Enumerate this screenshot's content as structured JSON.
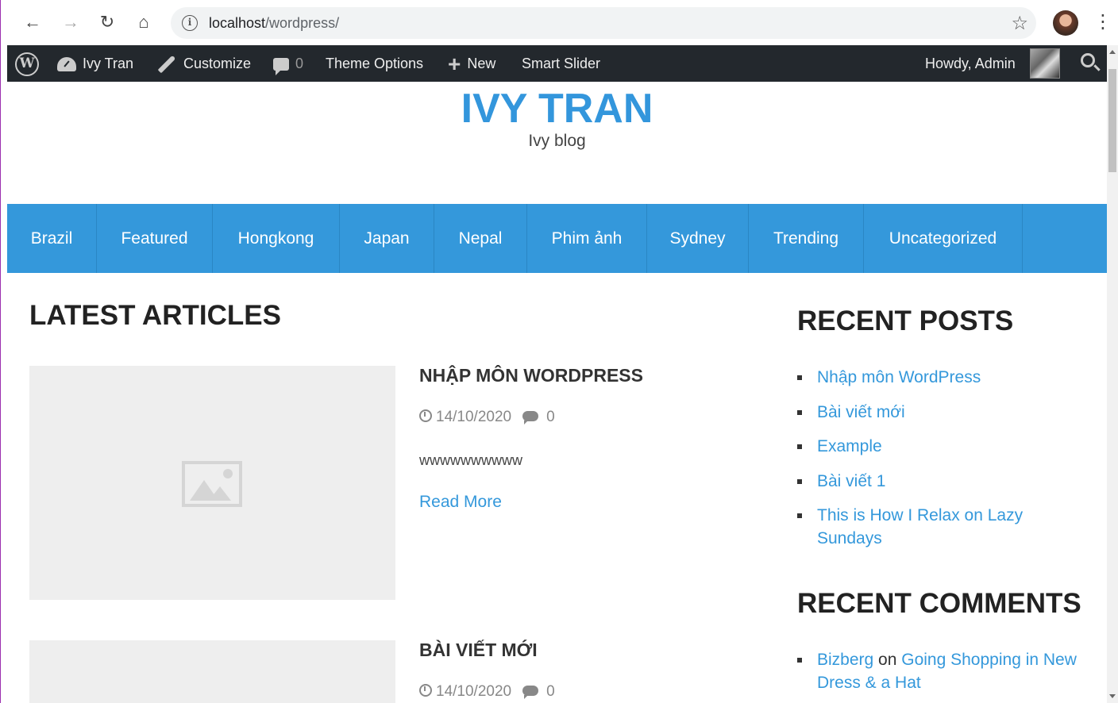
{
  "browser": {
    "url_host": "localhost",
    "url_path": "/wordpress/"
  },
  "adminbar": {
    "site_name": "Ivy Tran",
    "customize": "Customize",
    "comments_count": "0",
    "theme_options": "Theme Options",
    "new": "New",
    "smart_slider": "Smart Slider",
    "howdy": "Howdy, Admin"
  },
  "site": {
    "title": "IVY TRAN",
    "description": "Ivy blog"
  },
  "nav": {
    "items": [
      "Brazil",
      "Featured",
      "Hongkong",
      "Japan",
      "Nepal",
      "Phim ảnh",
      "Sydney",
      "Trending",
      "Uncategorized"
    ]
  },
  "main": {
    "heading": "LATEST ARTICLES",
    "posts": [
      {
        "title": "NHẬP MÔN WORDPRESS",
        "date": "14/10/2020",
        "comments": "0",
        "excerpt": "wwwwwwwwww",
        "read_more": "Read More"
      },
      {
        "title": "BÀI VIẾT MỚI",
        "date": "14/10/2020",
        "comments": "0"
      }
    ]
  },
  "sidebar": {
    "recent_posts_heading": "RECENT POSTS",
    "recent_posts": [
      "Nhập môn WordPress",
      "Bài viết mới",
      "Example",
      "Bài viết 1",
      "This is How I Relax on Lazy Sundays"
    ],
    "recent_comments_heading": "RECENT COMMENTS",
    "recent_comments": [
      {
        "author": "Bizberg",
        "joiner": "on",
        "post": "Going Shopping in New Dress & a Hat"
      }
    ]
  },
  "colors": {
    "accent": "#3498db",
    "adminbar": "#23282d"
  }
}
